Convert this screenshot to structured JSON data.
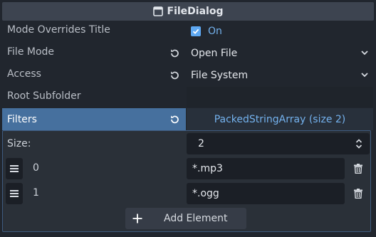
{
  "header": {
    "title": "FileDialog",
    "icon": "window-icon"
  },
  "properties": [
    {
      "label": "Mode Overrides Title",
      "value": "On",
      "checked": true,
      "type": "checkbox"
    },
    {
      "label": "File Mode",
      "value": "Open File",
      "type": "dropdown",
      "revertable": true
    },
    {
      "label": "Access",
      "value": "File System",
      "type": "dropdown",
      "revertable": true
    },
    {
      "label": "Root Subfolder",
      "value": "",
      "type": "text"
    }
  ],
  "filters": {
    "label": "Filters",
    "summary": "PackedStringArray (size 2)",
    "size_label": "Size:",
    "size_value": "2",
    "items": [
      {
        "index": "0",
        "value": "*.mp3"
      },
      {
        "index": "1",
        "value": "*.ogg"
      }
    ],
    "add_label": "Add Element"
  },
  "colors": {
    "background": "#21262e",
    "header": "#3d4450",
    "selected_row": "#46709e",
    "accent": "#5ea8f2",
    "link_text": "#74b2ee"
  }
}
